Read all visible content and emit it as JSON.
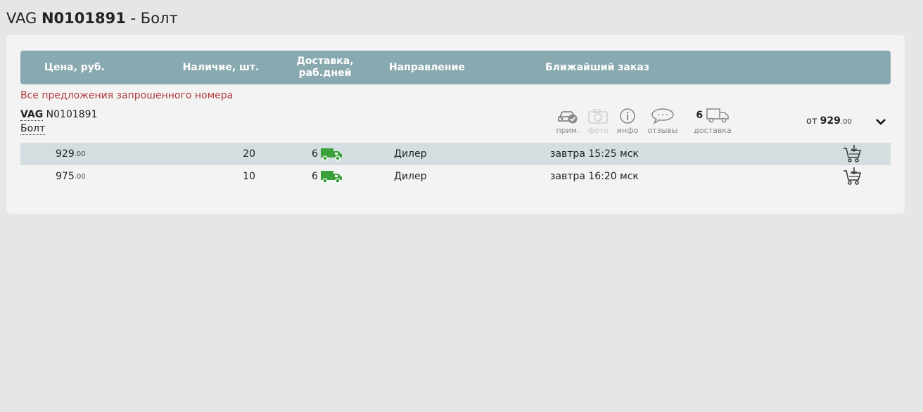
{
  "page": {
    "title_brand": "VAG",
    "title_number": "N0101891",
    "title_sep": " - ",
    "title_name": "Болт"
  },
  "table": {
    "headers": {
      "price": "Цена, руб.",
      "stock": "Наличие, шт.",
      "delivery_line1": "Доставка,",
      "delivery_line2": "раб.дней",
      "direction": "Направление",
      "nearest_order": "Ближайший заказ"
    }
  },
  "offers": {
    "title": "Все предложения запрошенного номера",
    "brand": "VAG",
    "number": "N0101891",
    "name": "Болт",
    "tools": {
      "applicability": "прим.",
      "photo": "фото",
      "info": "инфо",
      "reviews": "отзывы",
      "delivery_count": "6",
      "delivery": "доставка"
    },
    "price_from_prefix": "от",
    "price_from_int": "929",
    "price_from_frac": ".00",
    "rows": [
      {
        "price_int": "929",
        "price_frac": ".00",
        "stock": "20",
        "days": "6",
        "direction": "Дилер",
        "nearest": "завтра 15:25 мск"
      },
      {
        "price_int": "975",
        "price_frac": ".00",
        "stock": "10",
        "days": "6",
        "direction": "Дилер",
        "nearest": "завтра 16:20 мск"
      }
    ]
  },
  "colors": {
    "header_bg": "#88a9af",
    "offers_title": "#b23a3a",
    "truck_green": "#3aa13a",
    "row_shaded": "#d4dee0"
  },
  "icons": {
    "car_check": "car-check-icon",
    "photo": "camera-icon",
    "info": "info-icon",
    "reviews": "speech-bubble-icon",
    "truck": "truck-icon",
    "cart": "cart-add-icon",
    "chevron": "chevron-down-icon"
  }
}
